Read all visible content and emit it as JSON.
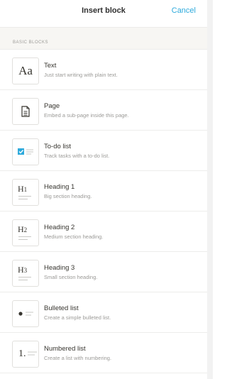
{
  "header": {
    "title": "Insert block",
    "cancel_label": "Cancel"
  },
  "section": {
    "label": "BASIC BLOCKS"
  },
  "blocks": [
    {
      "title": "Text",
      "desc": "Just start writing with plain text.",
      "icon": "text-aa-icon",
      "glyph": "Aa"
    },
    {
      "title": "Page",
      "desc": "Embed a sub-page inside this page.",
      "icon": "page-icon"
    },
    {
      "title": "To-do list",
      "desc": "Track tasks with a to-do list.",
      "icon": "checkbox-icon",
      "accent": "#2eaadc"
    },
    {
      "title": "Heading 1",
      "desc": "Big section heading.",
      "icon": "heading-1-icon",
      "glyph": "H",
      "glyph_sub": "1"
    },
    {
      "title": "Heading 2",
      "desc": "Medium section heading.",
      "icon": "heading-2-icon",
      "glyph": "H",
      "glyph_sub": "2"
    },
    {
      "title": "Heading 3",
      "desc": "Small section heading.",
      "icon": "heading-3-icon",
      "glyph": "H",
      "glyph_sub": "3"
    },
    {
      "title": "Bulleted list",
      "desc": "Create a simple bulleted list.",
      "icon": "bulleted-list-icon"
    },
    {
      "title": "Numbered list",
      "desc": "Create a list with numbering.",
      "icon": "numbered-list-icon",
      "glyph": "1."
    }
  ]
}
